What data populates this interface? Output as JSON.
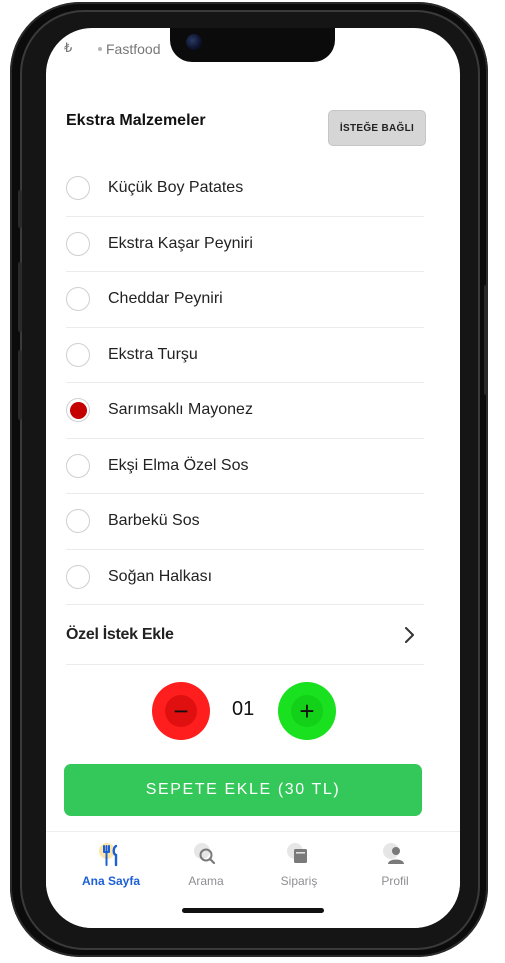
{
  "header": {
    "currency_symbol": "₺",
    "breadcrumb": "Fastfood"
  },
  "extras": {
    "title": "Ekstra Malzemeler",
    "badge": "İSTEĞE BAĞLI",
    "options": [
      {
        "label": "Küçük Boy Patates",
        "selected": false
      },
      {
        "label": "Ekstra Kaşar Peyniri",
        "selected": false
      },
      {
        "label": "Cheddar Peyniri",
        "selected": false
      },
      {
        "label": "Ekstra Turşu",
        "selected": false
      },
      {
        "label": "Sarımsaklı Mayonez",
        "selected": true
      },
      {
        "label": "Ekşi Elma Özel Sos",
        "selected": false
      },
      {
        "label": "Barbekü Sos",
        "selected": false
      },
      {
        "label": "Soğan Halkası",
        "selected": false
      }
    ]
  },
  "special_request": {
    "label": "Özel İstek Ekle"
  },
  "quantity": {
    "value": "01",
    "minus": "−",
    "plus": "+"
  },
  "cart_button": {
    "label": "SEPETE EKLE (30 TL)"
  },
  "tabs": [
    {
      "label": "Ana Sayfa",
      "icon": "cutlery-icon",
      "active": true
    },
    {
      "label": "Arama",
      "icon": "search-icon",
      "active": false
    },
    {
      "label": "Sipariş",
      "icon": "order-icon",
      "active": false
    },
    {
      "label": "Profil",
      "icon": "profile-icon",
      "active": false
    }
  ],
  "colors": {
    "selected_radio": "#c40000",
    "minus_button": "#ff1e1e",
    "plus_button": "#19e11f",
    "cart_button": "#34c759",
    "active_tab": "#1d5fd6"
  }
}
